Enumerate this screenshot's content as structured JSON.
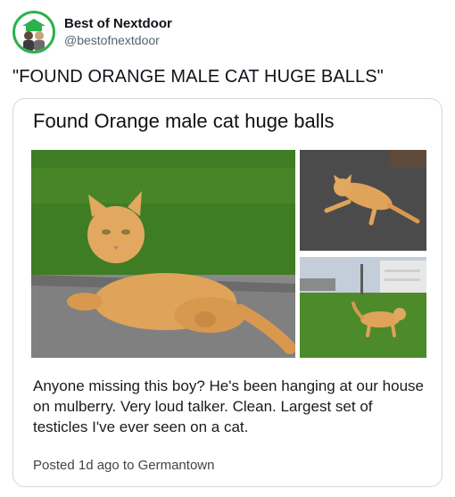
{
  "account": {
    "display_name": "Best of Nextdoor",
    "handle": "@bestofnextdoor",
    "avatar_icon": "nextdoor-house-people-avatar",
    "avatar_accent": "#2bb24c"
  },
  "tweet": {
    "text": "\"FOUND ORANGE MALE CAT HUGE BALLS\""
  },
  "post": {
    "title": "Found Orange male cat huge balls",
    "body": "Anyone missing this boy? He's been hanging at our house on mulberry. Very loud talker. Clean. Largest set of testicles I've ever seen on a cat.",
    "meta": "Posted 1d ago to Germantown",
    "photos": [
      "cat-lying-on-driveway-photo",
      "cat-lying-on-gravel-photo",
      "cat-walking-on-lawn-photo"
    ]
  }
}
